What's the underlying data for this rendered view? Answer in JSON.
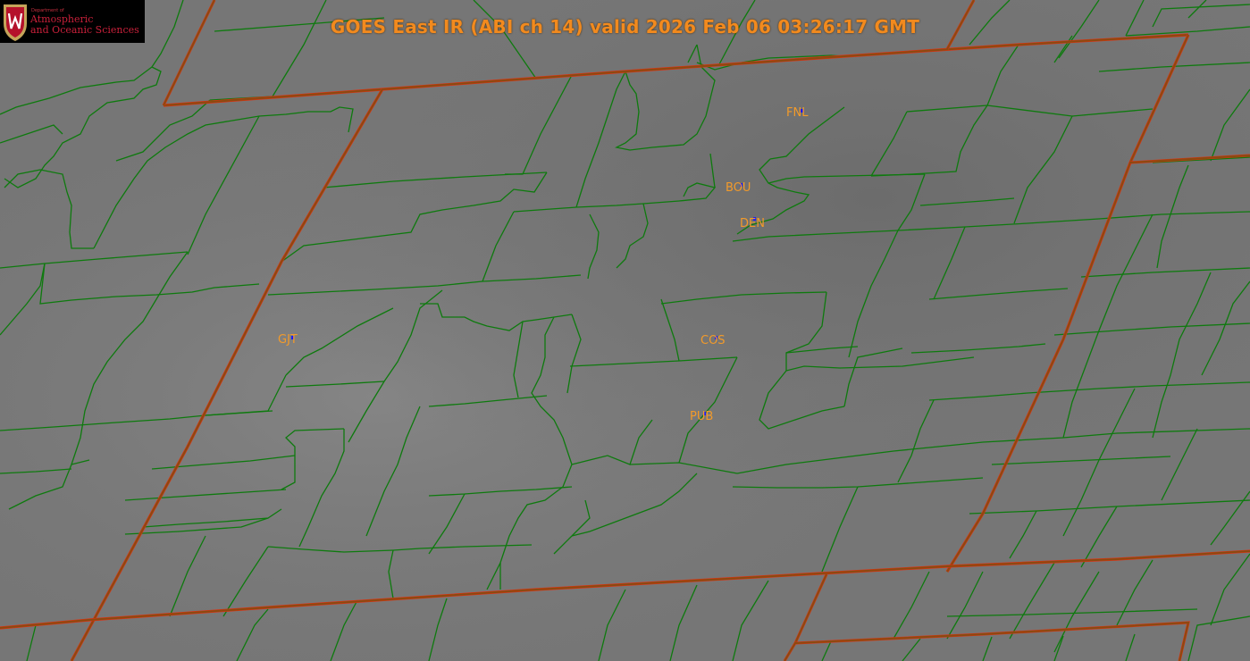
{
  "title": "GOES East IR (ABI ch 14) valid 2026 Feb 06 03:26:17 GMT",
  "logo": {
    "line1": "Department of",
    "line2": "Atmospheric",
    "line3": "and Oceanic Sciences"
  },
  "stations": [
    {
      "id": "FNL",
      "label": "FNL"
    },
    {
      "id": "BOU",
      "label": "BOU"
    },
    {
      "id": "DEN",
      "label": "DEN"
    },
    {
      "id": "GJT",
      "label": "GJT"
    },
    {
      "id": "COS",
      "label": "COS"
    },
    {
      "id": "PUB",
      "label": "PUB"
    }
  ],
  "colors": {
    "background": "#767676",
    "county_lines": "#0e7a0e",
    "state_lines": "#8a4a10",
    "state_line_edge": "#e03010",
    "labels": "#f29a2a",
    "station_marker": "#1a1aff"
  }
}
